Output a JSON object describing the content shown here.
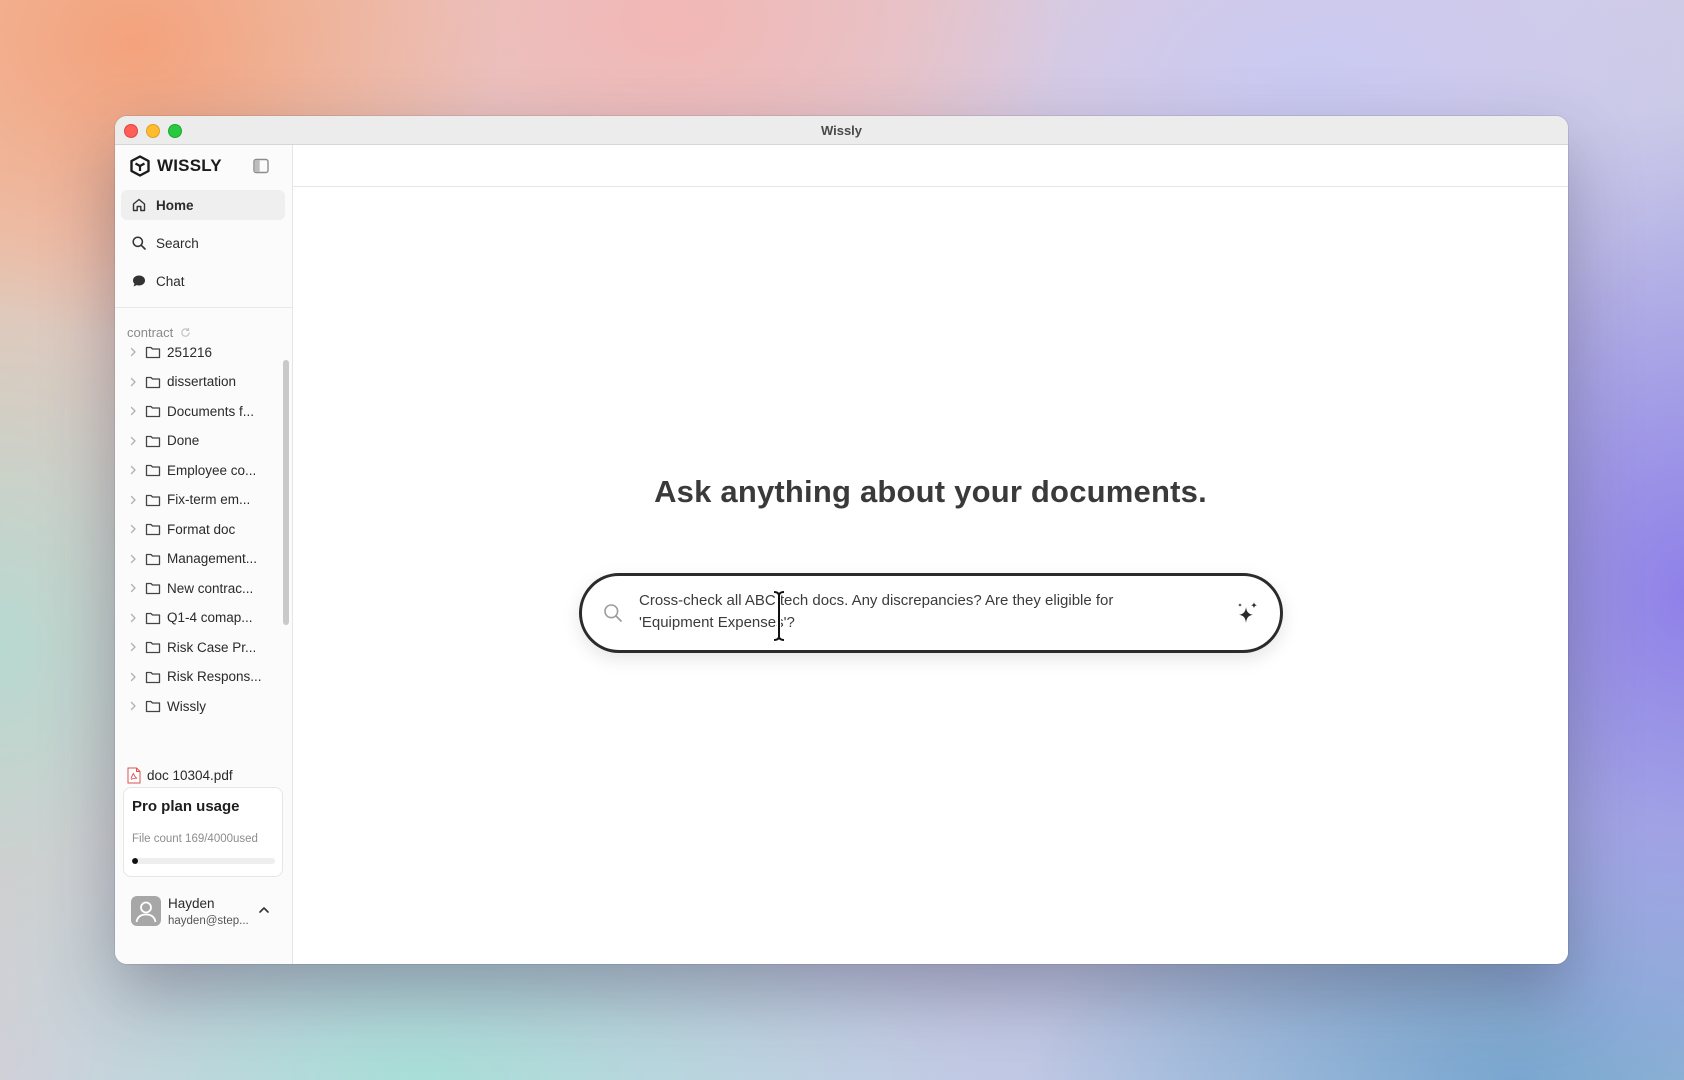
{
  "window": {
    "title": "Wissly"
  },
  "sidebar": {
    "brand": "WISSLY",
    "nav": [
      {
        "label": "Home",
        "icon": "home-icon",
        "active": true
      },
      {
        "label": "Search",
        "icon": "search-icon"
      },
      {
        "label": "Chat",
        "icon": "chat-bubble-icon"
      }
    ],
    "section": {
      "label": "contract",
      "icon": "refresh-icon"
    },
    "folders": [
      "251216",
      "dissertation",
      "Documents f...",
      "Done",
      "Employee co...",
      "Fix-term em...",
      "Format doc",
      "Management...",
      "New contrac...",
      "Q1-4 comap...",
      "Risk Case Pr...",
      "Risk Respons...",
      "Wissly"
    ],
    "file": {
      "label": "doc 10304.pdf",
      "icon": "pdf-file-icon"
    },
    "plan": {
      "title": "Pro plan usage",
      "count_text": "File count 169/4000used",
      "used": 169,
      "total": 4000
    },
    "user": {
      "name": "Hayden",
      "email": "hayden@step..."
    }
  },
  "main": {
    "headline": "Ask anything about your documents.",
    "query": "Cross-check all ABC tech docs. Any discrepancies? Are they eligible for 'Equipment Expenses'?"
  },
  "colors": {
    "traffic_red": "#ff5f57",
    "traffic_yellow": "#febc2e",
    "traffic_green": "#28c840",
    "accent": "#111111"
  }
}
